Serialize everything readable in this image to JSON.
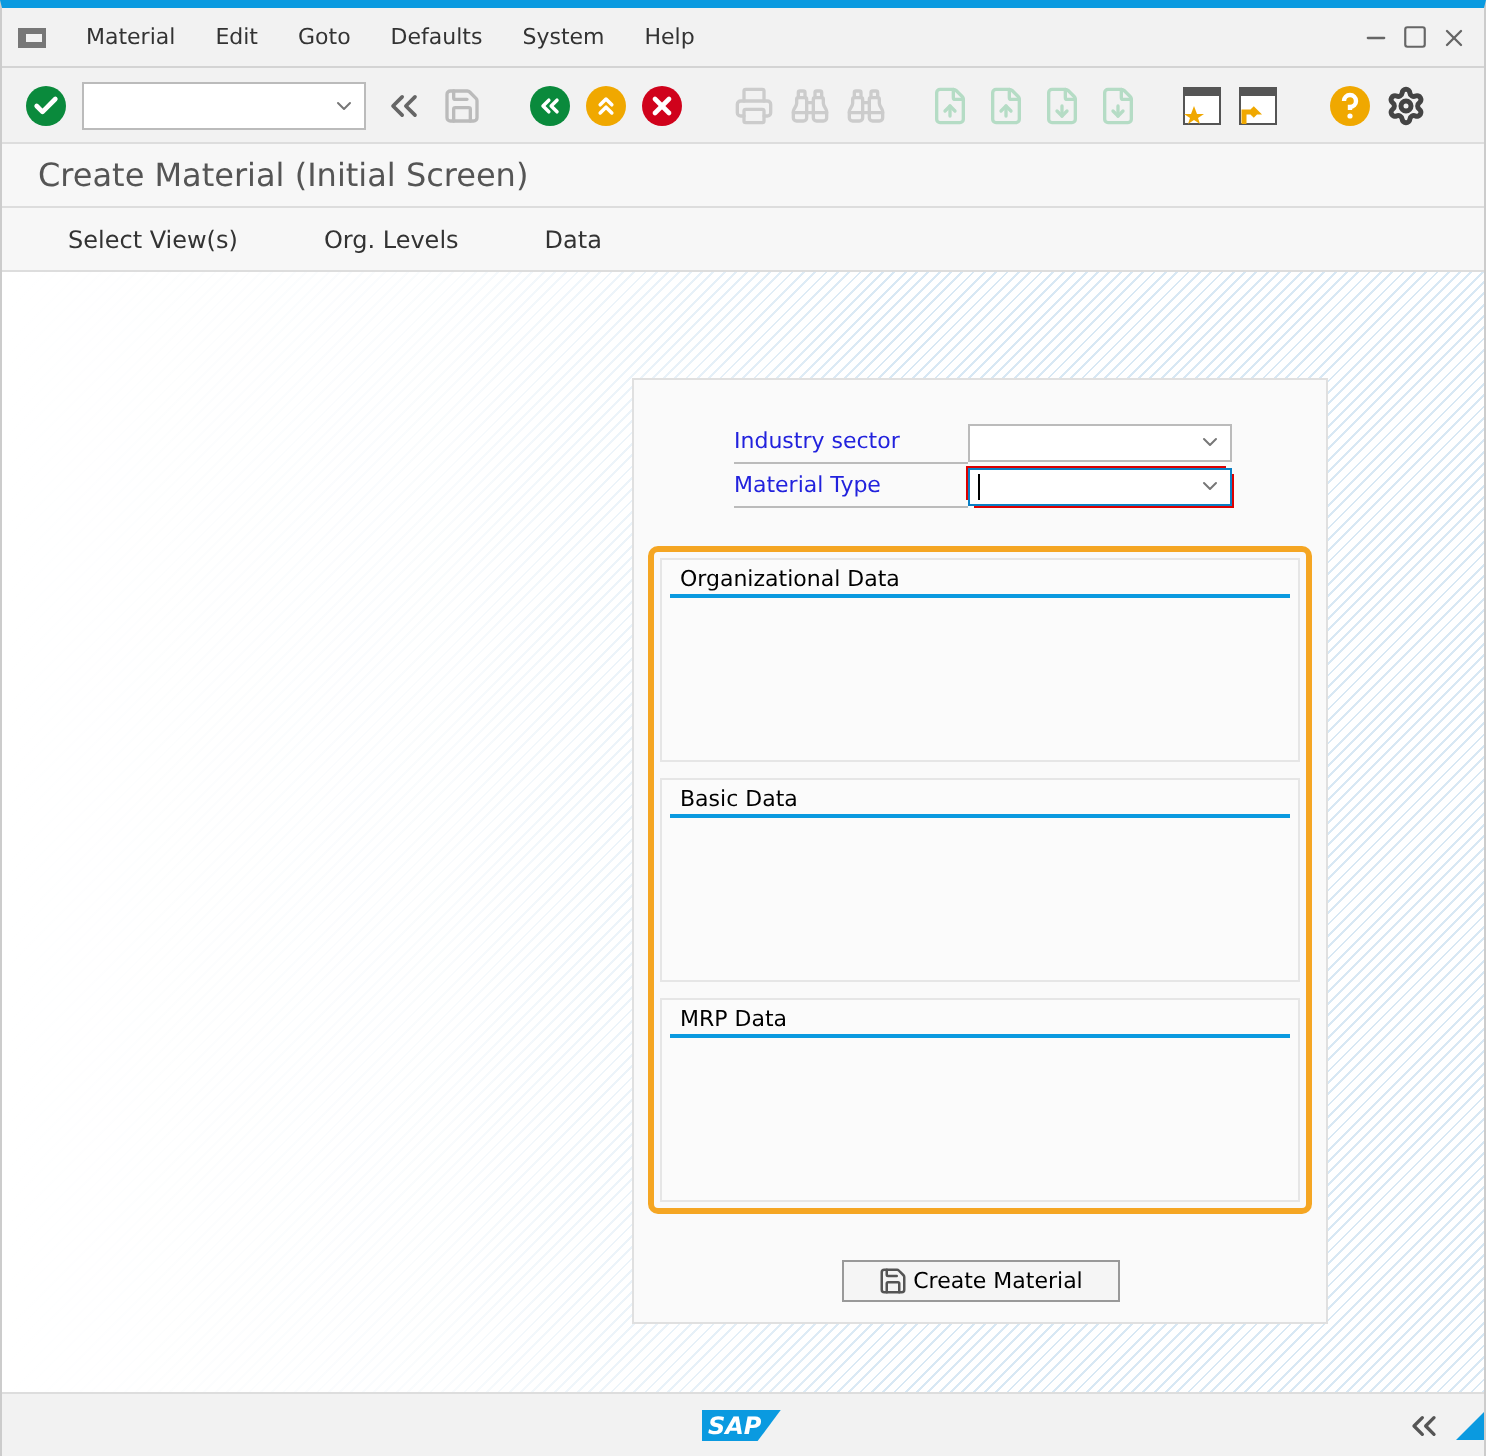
{
  "menu": [
    "Material",
    "Edit",
    "Goto",
    "Defaults",
    "System",
    "Help"
  ],
  "title": "Create Material (Initial Screen)",
  "app_toolbar": [
    "Select View(s)",
    "Org. Levels",
    "Data"
  ],
  "fields": [
    {
      "label": "Industry sector",
      "focused": false,
      "required": false
    },
    {
      "label": "Material Type",
      "focused": true,
      "required": true
    }
  ],
  "groups": [
    {
      "title": "Organizational Data"
    },
    {
      "title": "Basic Data"
    },
    {
      "title": "MRP Data"
    }
  ],
  "highlighted": true,
  "create_button": "Create Material",
  "status_bar": {
    "logo": "SAP"
  }
}
